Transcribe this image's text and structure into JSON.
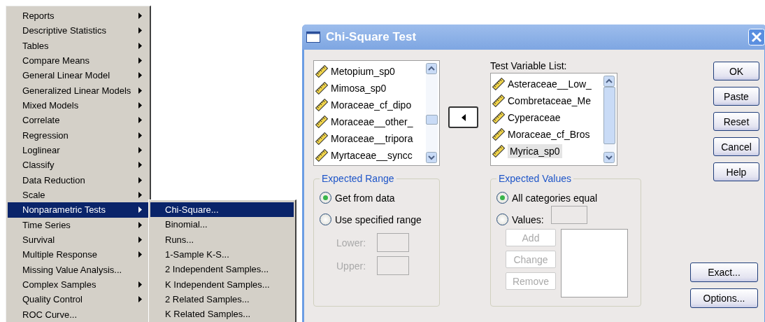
{
  "menu": {
    "items": [
      {
        "label": "Reports",
        "submenu": true,
        "selected": false
      },
      {
        "label": "Descriptive Statistics",
        "submenu": true,
        "selected": false
      },
      {
        "label": "Tables",
        "submenu": true,
        "selected": false
      },
      {
        "label": "Compare Means",
        "submenu": true,
        "selected": false
      },
      {
        "label": "General Linear Model",
        "submenu": true,
        "selected": false
      },
      {
        "label": "Generalized Linear Models",
        "submenu": true,
        "selected": false
      },
      {
        "label": "Mixed Models",
        "submenu": true,
        "selected": false
      },
      {
        "label": "Correlate",
        "submenu": true,
        "selected": false
      },
      {
        "label": "Regression",
        "submenu": true,
        "selected": false
      },
      {
        "label": "Loglinear",
        "submenu": true,
        "selected": false
      },
      {
        "label": "Classify",
        "submenu": true,
        "selected": false
      },
      {
        "label": "Data Reduction",
        "submenu": true,
        "selected": false
      },
      {
        "label": "Scale",
        "submenu": true,
        "selected": false
      },
      {
        "label": "Nonparametric Tests",
        "submenu": true,
        "selected": true
      },
      {
        "label": "Time Series",
        "submenu": true,
        "selected": false
      },
      {
        "label": "Survival",
        "submenu": true,
        "selected": false
      },
      {
        "label": "Multiple Response",
        "submenu": true,
        "selected": false
      },
      {
        "label": "Missing Value Analysis...",
        "submenu": false,
        "selected": false
      },
      {
        "label": "Complex Samples",
        "submenu": true,
        "selected": false
      },
      {
        "label": "Quality Control",
        "submenu": true,
        "selected": false
      },
      {
        "label": "ROC Curve...",
        "submenu": false,
        "selected": false
      }
    ]
  },
  "submenu": {
    "items": [
      {
        "label": "Chi-Square...",
        "selected": true
      },
      {
        "label": "Binomial...",
        "selected": false
      },
      {
        "label": "Runs...",
        "selected": false
      },
      {
        "label": "1-Sample K-S...",
        "selected": false
      },
      {
        "label": "2 Independent Samples...",
        "selected": false
      },
      {
        "label": "K Independent Samples...",
        "selected": false
      },
      {
        "label": "2 Related Samples...",
        "selected": false
      },
      {
        "label": "K Related Samples...",
        "selected": false
      }
    ]
  },
  "dialog": {
    "title": "Chi-Square Test",
    "source_list": {
      "items": [
        {
          "label": "Metopium_sp0",
          "selected": false
        },
        {
          "label": "Mimosa_sp0",
          "selected": false
        },
        {
          "label": "Moraceae_cf_dipo",
          "selected": false
        },
        {
          "label": "Moraceae__other_",
          "selected": false
        },
        {
          "label": "Moraceae__tripora",
          "selected": false
        },
        {
          "label": "Myrtaceae__syncc",
          "selected": false
        }
      ]
    },
    "target_list": {
      "label": "Test Variable List:",
      "items": [
        {
          "label": "Asteraceae__Low_",
          "selected": false
        },
        {
          "label": "Combretaceae_Me",
          "selected": false
        },
        {
          "label": "Cyperaceae",
          "selected": false
        },
        {
          "label": "Moraceae_cf_Bros",
          "selected": false
        },
        {
          "label": "Myrica_sp0",
          "selected": true
        }
      ]
    },
    "expected_range": {
      "title": "Expected Range",
      "options": [
        {
          "label": "Get from data",
          "selected": true
        },
        {
          "label": "Use specified range",
          "selected": false
        }
      ],
      "fields": [
        {
          "label": "Lower:",
          "disabled": true
        },
        {
          "label": "Upper:",
          "disabled": true
        }
      ]
    },
    "expected_values": {
      "title": "Expected Values",
      "options": [
        {
          "label": "All categories equal",
          "selected": true
        },
        {
          "label": "Values:",
          "selected": false,
          "field": {
            "disabled": true
          }
        }
      ],
      "buttons": [
        {
          "label": "Add",
          "disabled": true
        },
        {
          "label": "Change",
          "disabled": true
        },
        {
          "label": "Remove",
          "disabled": true
        }
      ]
    },
    "buttons": [
      {
        "label": "OK"
      },
      {
        "label": "Paste"
      },
      {
        "label": "Reset"
      },
      {
        "label": "Cancel"
      },
      {
        "label": "Help"
      }
    ],
    "bottom_buttons": [
      {
        "label": "Exact..."
      },
      {
        "label": "Options..."
      }
    ]
  }
}
